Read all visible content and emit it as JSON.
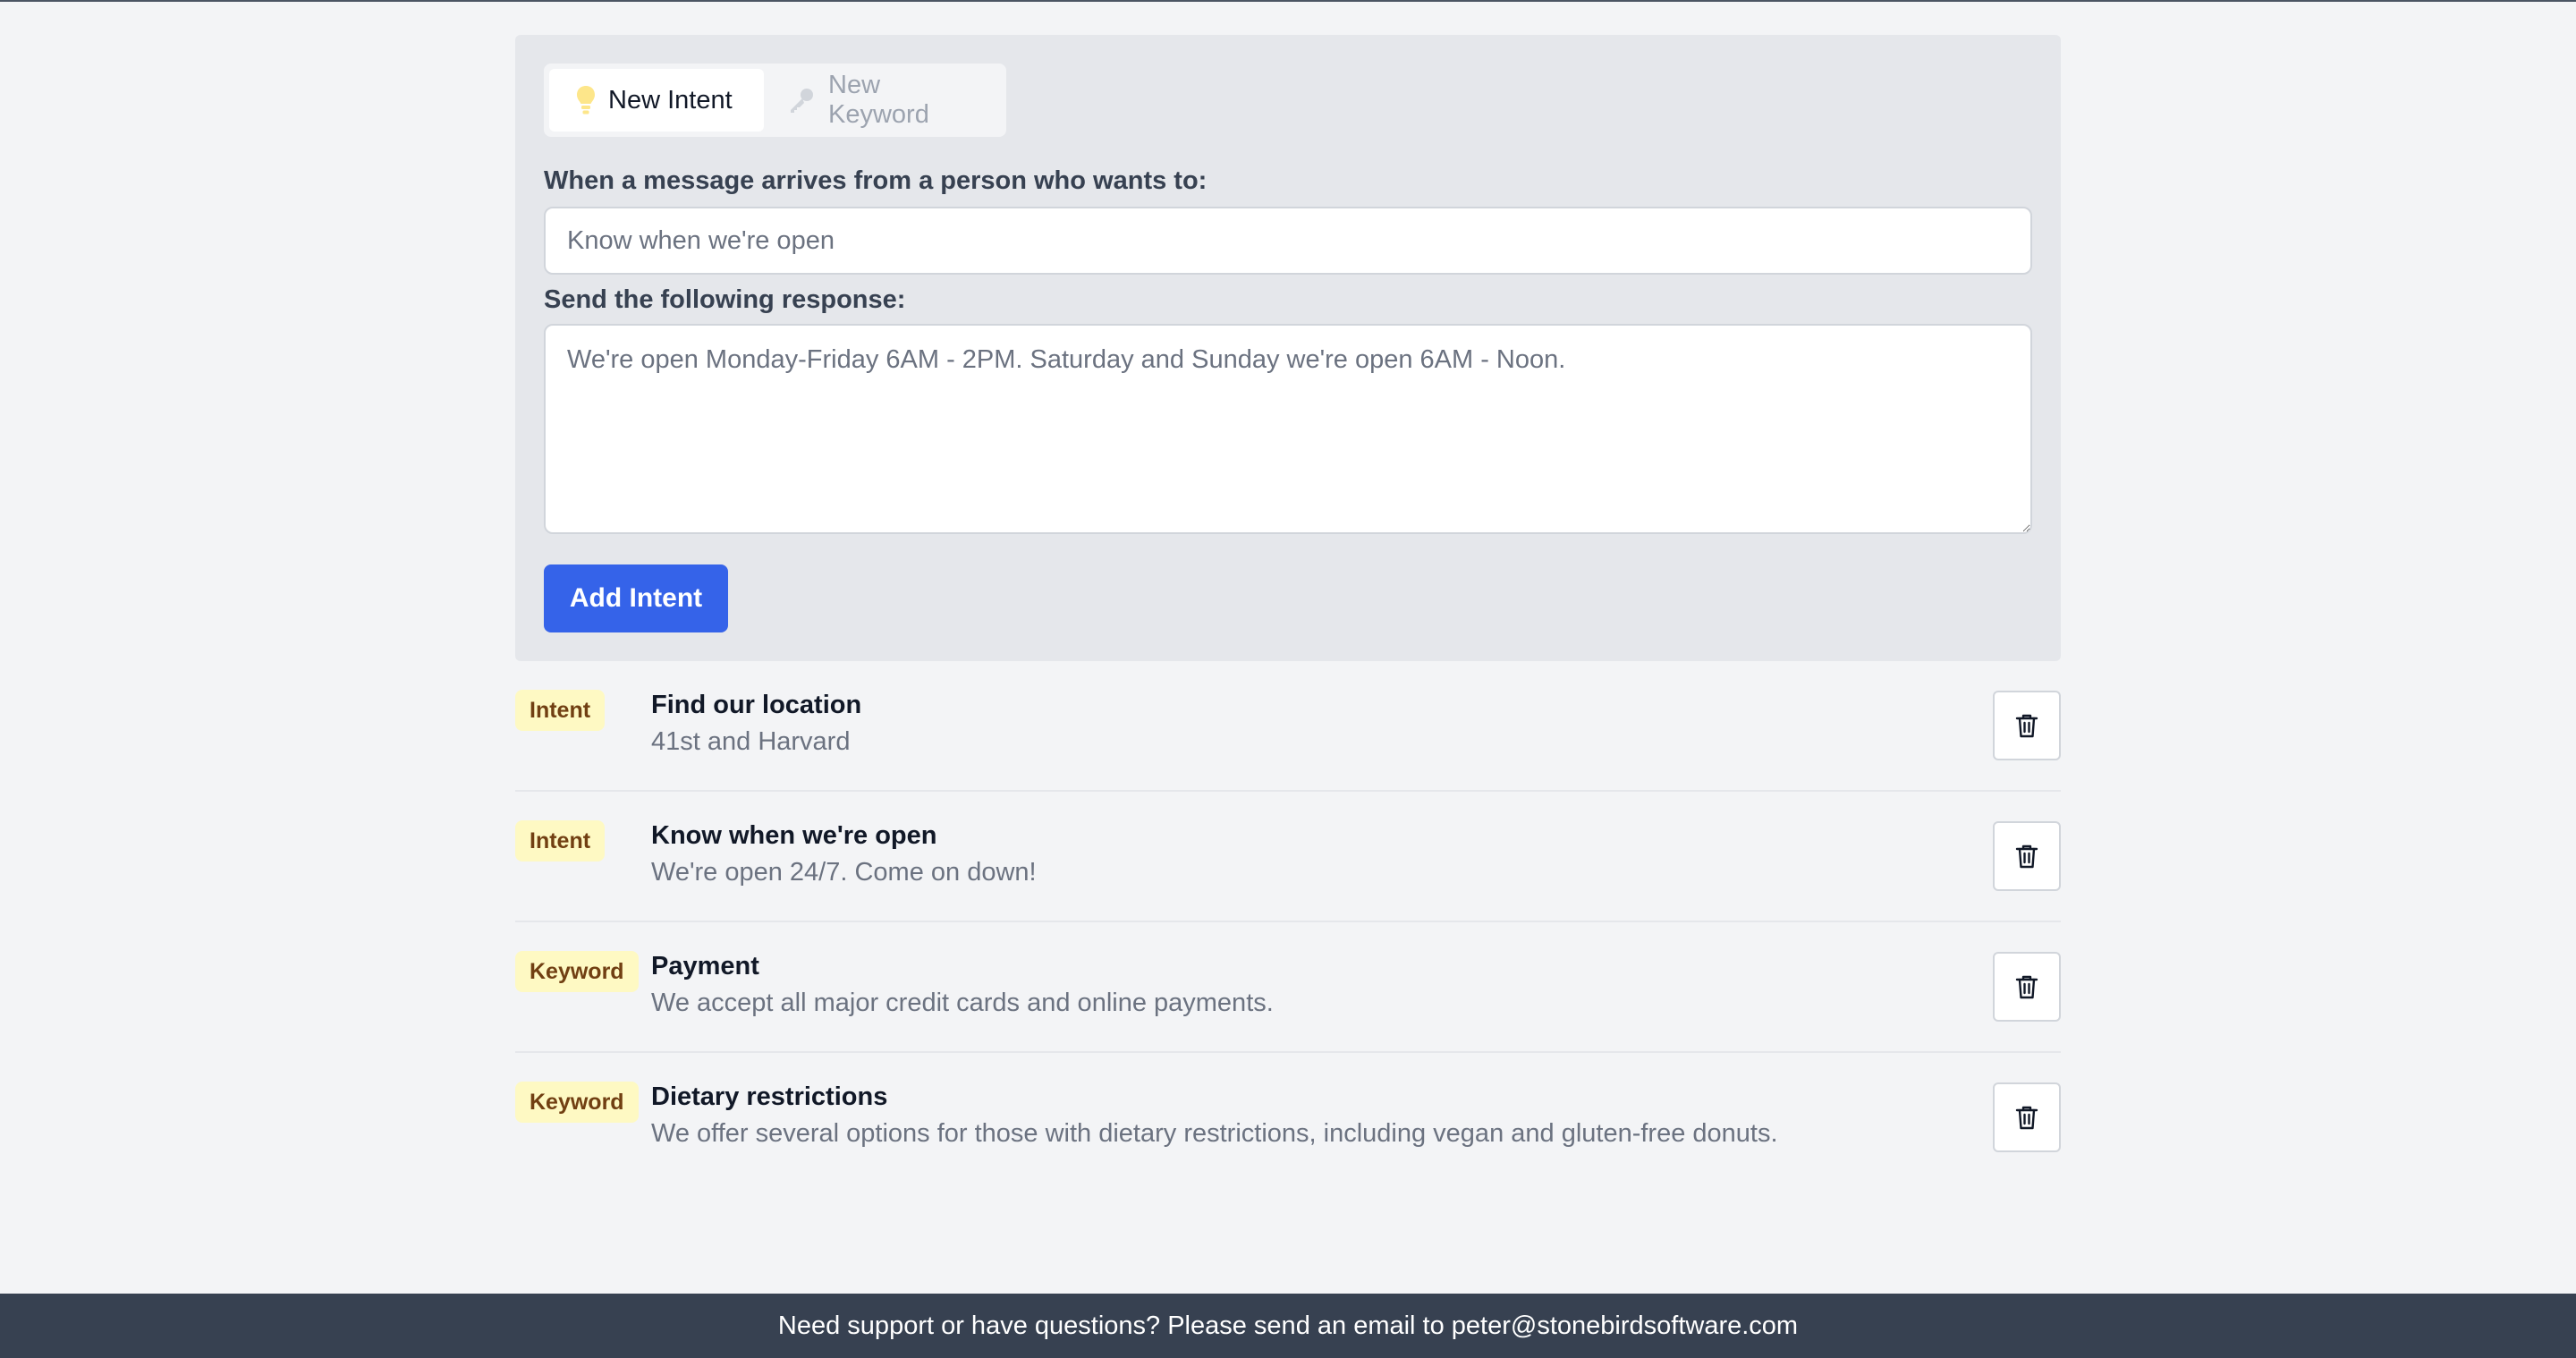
{
  "tabs": {
    "new_intent": {
      "label": "New Intent",
      "icon": "lightbulb-icon"
    },
    "new_keyword": {
      "label": "New Keyword",
      "icon": "key-icon"
    }
  },
  "form": {
    "intent_label": "When a message arrives from a person who wants to:",
    "intent_value": "Know when we're open",
    "response_label": "Send the following response:",
    "response_value": "We're open Monday-Friday 6AM - 2PM. Saturday and Sunday we're open 6AM - Noon.",
    "submit_label": "Add Intent"
  },
  "items": [
    {
      "type": "Intent",
      "title": "Find our location",
      "description": "41st and Harvard"
    },
    {
      "type": "Intent",
      "title": "Know when we're open",
      "description": "We're open 24/7. Come on down!"
    },
    {
      "type": "Keyword",
      "title": "Payment",
      "description": "We accept all major credit cards and online payments."
    },
    {
      "type": "Keyword",
      "title": "Dietary restrictions",
      "description": "We offer several options for those with dietary restrictions, including vegan and gluten-free donuts."
    }
  ],
  "footer": {
    "text": "Need support or have questions? Please send an email to peter@stonebirdsoftware.com"
  },
  "colors": {
    "accent": "#3563e9",
    "badge_bg": "#fef9c3",
    "footer_bg": "#374151"
  }
}
